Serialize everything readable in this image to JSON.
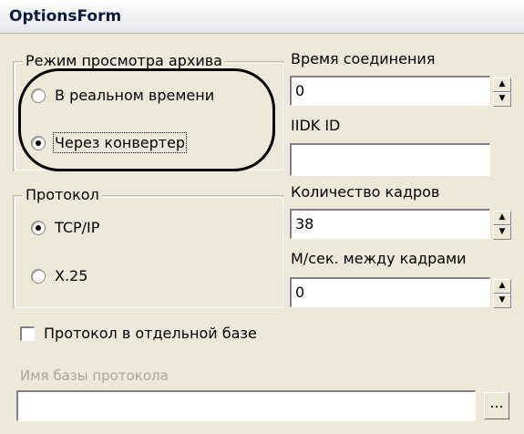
{
  "window": {
    "title": "OptionsForm"
  },
  "archive_mode": {
    "legend": "Режим просмотра архива",
    "options": [
      {
        "label": "В реальном времени",
        "selected": false
      },
      {
        "label": "Через конвертер",
        "selected": true
      }
    ]
  },
  "connection_time": {
    "label": "Время соединения",
    "value": "0"
  },
  "iidk_id": {
    "label": "IIDK ID",
    "value": ""
  },
  "protocol": {
    "legend": "Протокол",
    "options": [
      {
        "label": "TCP/IP",
        "selected": true
      },
      {
        "label": "X.25",
        "selected": false
      }
    ]
  },
  "frame_count": {
    "label": "Количество кадров",
    "value": "38"
  },
  "ms_between_frames": {
    "label": "М/сек. между кадрами",
    "value": "0"
  },
  "separate_db": {
    "label": "Протокол в отдельной базе",
    "checked": false
  },
  "db_name": {
    "label": "Имя базы протокола",
    "value": "",
    "browse_label": "..."
  },
  "colors": {
    "face": "#ece9d8",
    "disabled_text": "#a7a69a",
    "highlight_oval": "#000000"
  }
}
